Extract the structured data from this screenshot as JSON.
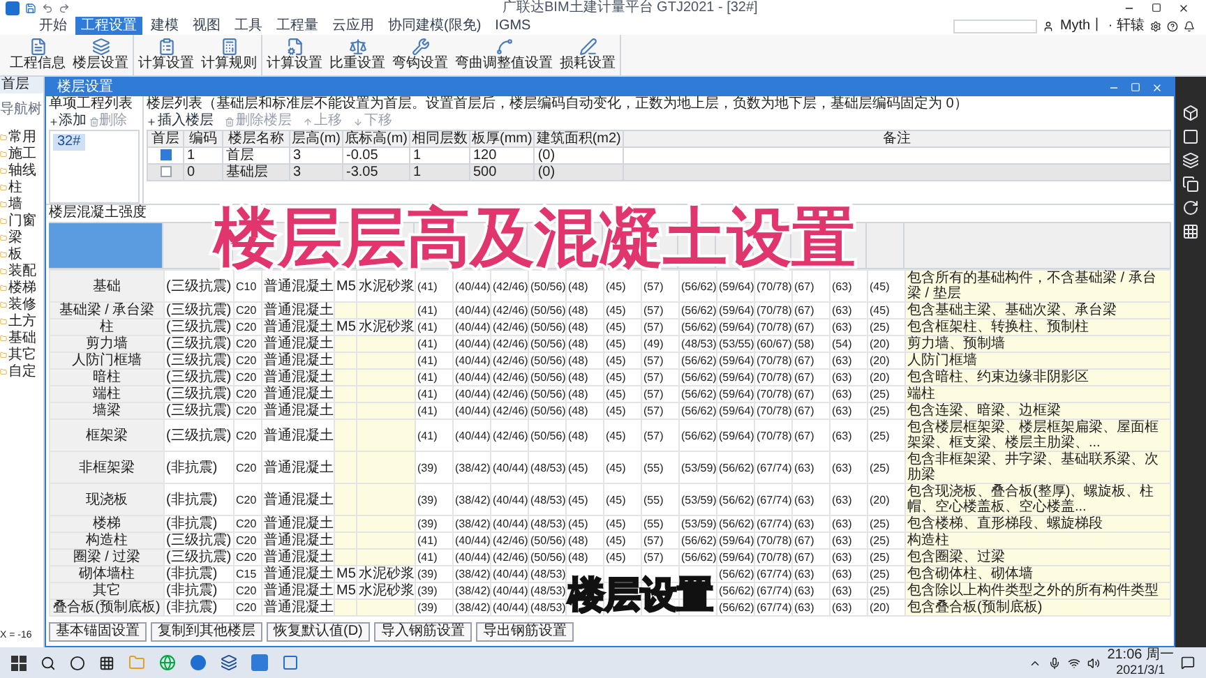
{
  "title_bar": {
    "title": "广联达BIM土建计量平台 GTJ2021 - [32#]",
    "user": "Myth丨 · 轩辕"
  },
  "menu_tabs": [
    {
      "label": "开始",
      "selected": false
    },
    {
      "label": "工程设置",
      "selected": true
    },
    {
      "label": "建模",
      "selected": false
    },
    {
      "label": "视图",
      "selected": false
    },
    {
      "label": "工具",
      "selected": false
    },
    {
      "label": "工程量",
      "selected": false
    },
    {
      "label": "云应用",
      "selected": false
    },
    {
      "label": "协同建模(限免)",
      "selected": false
    },
    {
      "label": "IGMS",
      "selected": false
    }
  ],
  "ribbon_groups": [
    {
      "buttons": [
        "工程信息",
        "楼层设置"
      ]
    },
    {
      "buttons": [
        "计算设置",
        "计算规则"
      ]
    },
    {
      "buttons": [
        "计算设置",
        "比重设置",
        "弯钩设置",
        "弯曲调整值设置",
        "损耗设置"
      ]
    }
  ],
  "navigator": {
    "tab": "首层",
    "title": "导航树",
    "items": [
      "常用",
      "施工",
      "轴线",
      "柱",
      "墙",
      "门窗",
      "梁",
      "板",
      "装配",
      "楼梯",
      "装修",
      "土方",
      "基础",
      "其它",
      "自定"
    ],
    "coords": "X = -16"
  },
  "dialog": {
    "title": "楼层设置",
    "project_list": {
      "title": "单项工程列表",
      "buttons": [
        {
          "label": "添加",
          "disabled": false
        },
        {
          "label": "删除",
          "disabled": true
        }
      ],
      "items": [
        {
          "label": "32#",
          "selected": true
        }
      ]
    },
    "floor_list": {
      "description": "楼层列表（基础层和标准层不能设置为首层。设置首层后，楼层编码自动变化，正数为地上层，负数为地下层，基础层编码固定为 0）",
      "toolbar": [
        {
          "label": "插入楼层",
          "disabled": false
        },
        {
          "label": "删除楼层",
          "disabled": true
        },
        {
          "label": "上移",
          "disabled": true
        },
        {
          "label": "下移",
          "disabled": true
        }
      ],
      "first_floor_column": "首层",
      "columns": [
        "编码",
        "楼层名称",
        "层高(m)",
        "底标高(m)",
        "相同层数",
        "板厚(mm)",
        "建筑面积(m2)",
        "备注"
      ],
      "rows": [
        {
          "first_floor": true,
          "selected": false,
          "cells": [
            "1",
            "首层",
            "3",
            "-0.05",
            "1",
            "120",
            "(0)"
          ]
        },
        {
          "first_floor": false,
          "selected": true,
          "cells": [
            "0",
            "基础层",
            "3",
            "-3.05",
            "1",
            "500",
            "(0)"
          ]
        }
      ]
    },
    "concrete": {
      "title": "楼层混凝土强度",
      "rows": [
        {
          "cells": [
            "基础",
            "(三级抗震)",
            "C10",
            "普通混凝土",
            "M5",
            "水泥砂浆",
            "(41)",
            "(40/44)",
            "(42/46)",
            "(50/56)",
            "(48)",
            "(45)",
            "(57)",
            "(56/62)",
            "(59/64)",
            "(70/78)",
            "(67)",
            "(63)",
            "(45)",
            "包含所有的基础构件，不含基础梁 / 承台梁 / 垫层"
          ]
        },
        {
          "cells": [
            "基础梁 / 承台梁",
            "(三级抗震)",
            "C20",
            "普通混凝土",
            null,
            null,
            "(41)",
            "(40/44)",
            "(42/46)",
            "(50/56)",
            "(48)",
            "(45)",
            "(57)",
            "(56/62)",
            "(59/64)",
            "(70/78)",
            "(67)",
            "(63)",
            "(45)",
            "包含基础主梁、基础次梁、承台梁"
          ]
        },
        {
          "cells": [
            "柱",
            "(三级抗震)",
            "C20",
            "普通混凝土",
            "M5",
            "水泥砂浆",
            "(41)",
            "(40/44)",
            "(42/46)",
            "(50/56)",
            "(48)",
            "(45)",
            "(57)",
            "(56/62)",
            "(59/64)",
            "(70/78)",
            "(67)",
            "(63)",
            "(25)",
            "包含框架柱、转换柱、预制柱"
          ]
        },
        {
          "cells": [
            "剪力墙",
            "(三级抗震)",
            "C20",
            "普通混凝土",
            null,
            null,
            "(41)",
            "(40/44)",
            "(42/46)",
            "(50/56)",
            "(48)",
            "(45)",
            "(49)",
            "(48/53)",
            "(53/55)",
            "(60/67)",
            "(58)",
            "(54)",
            "(20)",
            "剪力墙、预制墙"
          ]
        },
        {
          "cells": [
            "人防门框墙",
            "(三级抗震)",
            "C20",
            "普通混凝土",
            null,
            null,
            "(41)",
            "(40/44)",
            "(42/46)",
            "(50/56)",
            "(48)",
            "(45)",
            "(57)",
            "(56/62)",
            "(59/64)",
            "(70/78)",
            "(67)",
            "(63)",
            "(20)",
            "人防门框墙"
          ]
        },
        {
          "cells": [
            "暗柱",
            "(三级抗震)",
            "C20",
            "普通混凝土",
            null,
            null,
            "(41)",
            "(40/44)",
            "(42/46)",
            "(50/56)",
            "(48)",
            "(45)",
            "(57)",
            "(56/62)",
            "(59/64)",
            "(70/78)",
            "(67)",
            "(63)",
            "(20)",
            "包含暗柱、约束边缘非阴影区"
          ]
        },
        {
          "cells": [
            "端柱",
            "(三级抗震)",
            "C20",
            "普通混凝土",
            null,
            null,
            "(41)",
            "(40/44)",
            "(42/46)",
            "(50/56)",
            "(48)",
            "(45)",
            "(57)",
            "(56/62)",
            "(59/64)",
            "(70/78)",
            "(67)",
            "(63)",
            "(25)",
            "端柱"
          ]
        },
        {
          "cells": [
            "墙梁",
            "(三级抗震)",
            "C20",
            "普通混凝土",
            null,
            null,
            "(41)",
            "(40/44)",
            "(42/46)",
            "(50/56)",
            "(48)",
            "(45)",
            "(57)",
            "(56/62)",
            "(59/64)",
            "(70/78)",
            "(67)",
            "(63)",
            "(25)",
            "包含连梁、暗梁、边框梁"
          ]
        },
        {
          "cells": [
            "框架梁",
            "(三级抗震)",
            "C20",
            "普通混凝土",
            null,
            null,
            "(41)",
            "(40/44)",
            "(42/46)",
            "(50/56)",
            "(48)",
            "(45)",
            "(57)",
            "(56/62)",
            "(59/64)",
            "(70/78)",
            "(67)",
            "(63)",
            "(25)",
            "包含楼层框架梁、楼层框架扁梁、屋面框架梁、框支梁、楼层主肋梁、..."
          ]
        },
        {
          "cells": [
            "非框架梁",
            "(非抗震)",
            "C20",
            "普通混凝土",
            null,
            null,
            "(39)",
            "(38/42)",
            "(40/44)",
            "(48/53)",
            "(45)",
            "(45)",
            "(55)",
            "(53/59)",
            "(56/62)",
            "(67/74)",
            "(63)",
            "(63)",
            "(25)",
            "包含非框架梁、井字梁、基础联系梁、次肋梁"
          ]
        },
        {
          "cells": [
            "现浇板",
            "(非抗震)",
            "C20",
            "普通混凝土",
            null,
            null,
            "(39)",
            "(38/42)",
            "(40/44)",
            "(48/53)",
            "(45)",
            "(45)",
            "(55)",
            "(53/59)",
            "(56/62)",
            "(67/74)",
            "(63)",
            "(63)",
            "(20)",
            "包含现浇板、叠合板(整厚)、螺旋板、柱帽、空心楼盖板、空心楼盖..."
          ]
        },
        {
          "cells": [
            "楼梯",
            "(非抗震)",
            "C20",
            "普通混凝土",
            null,
            null,
            "(39)",
            "(38/42)",
            "(40/44)",
            "(48/53)",
            "(45)",
            "(45)",
            "(55)",
            "(53/59)",
            "(56/62)",
            "(67/74)",
            "(63)",
            "(63)",
            "(25)",
            "包含楼梯、直形梯段、螺旋梯段"
          ]
        },
        {
          "cells": [
            "构造柱",
            "(三级抗震)",
            "C20",
            "普通混凝土",
            null,
            null,
            "(41)",
            "(40/44)",
            "(42/46)",
            "(50/56)",
            "(48)",
            "(45)",
            "(57)",
            "(56/62)",
            "(59/64)",
            "(70/78)",
            "(67)",
            "(63)",
            "(25)",
            "构造柱"
          ]
        },
        {
          "cells": [
            "圈梁 / 过梁",
            "(三级抗震)",
            "C20",
            "普通混凝土",
            null,
            null,
            "(41)",
            "(40/44)",
            "(42/46)",
            "(50/56)",
            "(48)",
            "(45)",
            "(57)",
            "(56/62)",
            "(59/64)",
            "(70/78)",
            "(67)",
            "(63)",
            "(25)",
            "包含圈梁、过梁"
          ]
        },
        {
          "cells": [
            "砌体墙柱",
            "(非抗震)",
            "C15",
            "普通混凝土",
            "M5",
            "水泥砂浆",
            "(39)",
            "(38/42)",
            "(40/44)",
            "(48/53)",
            null,
            null,
            null,
            null,
            "(56/62)",
            "(67/74)",
            "(63)",
            "(63)",
            "(25)",
            "包含砌体柱、砌体墙"
          ]
        },
        {
          "cells": [
            "其它",
            "(非抗震)",
            "C20",
            "普通混凝土",
            "M5",
            "水泥砂浆",
            "(39)",
            "(38/42)",
            "(40/44)",
            "(48/53)",
            null,
            null,
            null,
            null,
            "(56/62)",
            "(67/74)",
            "(63)",
            "(63)",
            "(25)",
            "包含除以上构件类型之外的所有构件类型"
          ]
        },
        {
          "cells": [
            "叠合板(预制底板)",
            "(非抗震)",
            "C20",
            "普通混凝土",
            null,
            null,
            "(39)",
            "(38/42)",
            "(40/44)",
            "(48/53)",
            null,
            null,
            null,
            null,
            "(56/62)",
            "(67/74)",
            "(63)",
            "(63)",
            "(20)",
            "包含叠合板(预制底板)"
          ]
        }
      ]
    },
    "buttons": [
      "基本锚固设置",
      "复制到其他楼层",
      "恢复默认值(D)",
      "导入钢筋设置",
      "导出钢筋设置"
    ]
  },
  "captions": [
    {
      "kind": "title",
      "text": "楼层层高及混凝土设置"
    },
    {
      "kind": "subtitle",
      "text": "楼层设置"
    }
  ],
  "taskbar": {
    "time": "21:06 周一",
    "date": "2021/3/1"
  }
}
